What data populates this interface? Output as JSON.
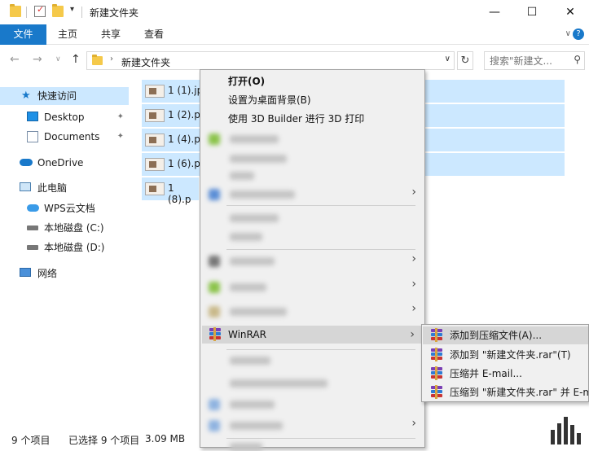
{
  "window": {
    "title": "新建文件夹",
    "minimize": "—",
    "maximize": "☐",
    "close": "✕"
  },
  "ribbon": {
    "tabs": [
      "文件",
      "主页",
      "共享",
      "查看"
    ],
    "expand": "∨",
    "help": "?"
  },
  "address": {
    "back": "←",
    "forward": "→",
    "recent": "∨",
    "up": "↑",
    "separator": "›",
    "path": "新建文件夹",
    "dropdown": "∨",
    "refresh": "↻",
    "search_placeholder": "搜索\"新建文...",
    "search_icon": "⚲"
  },
  "nav": {
    "items": [
      {
        "label": "快速访问",
        "icon": "star-icon"
      },
      {
        "label": "Desktop",
        "icon": "desktop-icon"
      },
      {
        "label": "Documents",
        "icon": "documents-icon"
      },
      {
        "label": "OneDrive",
        "icon": "cloud-icon"
      },
      {
        "label": "此电脑",
        "icon": "computer-icon"
      },
      {
        "label": "WPS云文档",
        "icon": "wps-cloud-icon"
      },
      {
        "label": "本地磁盘 (C:)",
        "icon": "drive-icon"
      },
      {
        "label": "本地磁盘 (D:)",
        "icon": "drive-icon"
      },
      {
        "label": "网络",
        "icon": "network-icon"
      }
    ],
    "pin": "📌"
  },
  "files": [
    {
      "name": "1 (1).jp"
    },
    {
      "name": "1 (2).p"
    },
    {
      "name": "1 (4).p"
    },
    {
      "name": "1 (6).p"
    },
    {
      "name": "1 (8).p"
    }
  ],
  "status": {
    "count": "9 个项目",
    "selected": "已选择 9 个项目",
    "size": "3.09 MB"
  },
  "context_menu": {
    "open": "打开(O)",
    "set_background": "设置为桌面背景(B)",
    "print_3d": "使用 3D Builder 进行 3D 打印",
    "winrar": "WinRAR",
    "submenu_arrow": "›"
  },
  "winrar_submenu": {
    "items": [
      "添加到压缩文件(A)...",
      "添加到 \"新建文件夹.rar\"(T)",
      "压缩并 E-mail...",
      "压缩到 \"新建文件夹.rar\" 并 E-mail"
    ]
  },
  "colors": {
    "accent": "#1979ca",
    "selection": "#cce8ff",
    "menu_bg": "#f0f0f0",
    "menu_hover": "#d6d6d6"
  }
}
